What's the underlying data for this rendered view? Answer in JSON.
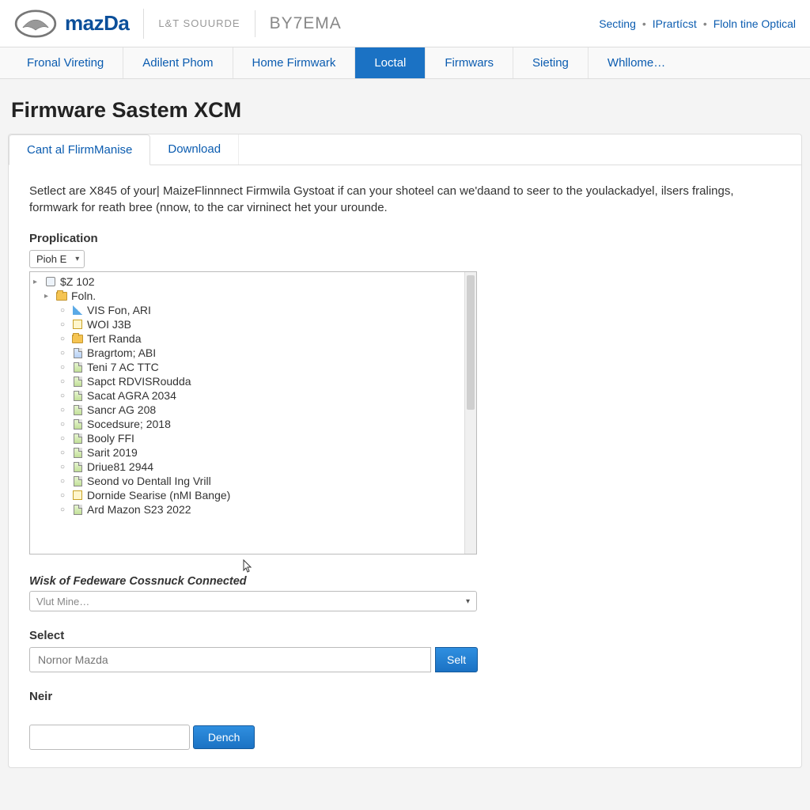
{
  "header": {
    "wordmark": "mazDa",
    "sub1": "L&T SOUURDE",
    "code": "BY7EMA",
    "links": [
      "Secting",
      "IPrartícst",
      "Floln tine Optical"
    ]
  },
  "nav": {
    "items": [
      "Fronal Vireting",
      "Adilent Phom",
      "Home Firmwark",
      "Loctal",
      "Firmwars",
      "Sieting",
      "Whllome…"
    ],
    "active_index": 3
  },
  "page": {
    "title": "Firmware Sastem XCM"
  },
  "tabs": {
    "items": [
      "Cant al FlirmManise",
      "Download"
    ],
    "active_index": 0
  },
  "intro": "Setlect are X845 of your| MaizeFlinnnect Firmwila Gystoat if can your shoteel can we'daand to seer to the youlackadyel, ilsers fralings, formwark for reath bree (nnow, to the car virninect het your urounde.",
  "proplication": {
    "label": "Proplication",
    "select_value": "Pioh  E",
    "tree": [
      {
        "lvl": 0,
        "icon": "db",
        "label": "$Z 102"
      },
      {
        "lvl": 1,
        "icon": "fold",
        "label": "Foln."
      },
      {
        "lvl": 2,
        "icon": "edit",
        "label": "VIS Fon, ARI"
      },
      {
        "lvl": 2,
        "icon": "note",
        "label": "WOI J3B"
      },
      {
        "lvl": 2,
        "icon": "fold",
        "label": "Tert Randa"
      },
      {
        "lvl": 2,
        "icon": "fb",
        "label": "Bragrtom; ABI"
      },
      {
        "lvl": 2,
        "icon": "fg",
        "label": "Teni 7 AC TTC"
      },
      {
        "lvl": 2,
        "icon": "fg",
        "label": "Sapct RDVISRoudda"
      },
      {
        "lvl": 2,
        "icon": "fg",
        "label": "Sacat AGRA 2034"
      },
      {
        "lvl": 2,
        "icon": "fg",
        "label": "Sancr AG 208"
      },
      {
        "lvl": 2,
        "icon": "fg",
        "label": "Socedsure; 2018"
      },
      {
        "lvl": 2,
        "icon": "fg",
        "label": "Booly FFI"
      },
      {
        "lvl": 2,
        "icon": "fg",
        "label": "Sarit 2019"
      },
      {
        "lvl": 2,
        "icon": "fg",
        "label": "Driue81 2944"
      },
      {
        "lvl": 2,
        "icon": "fg",
        "label": "Seond vo Dentall Ing Vrill"
      },
      {
        "lvl": 2,
        "icon": "note",
        "label": "Dornide Searise (nMI Bange)"
      },
      {
        "lvl": 2,
        "icon": "fg",
        "label": "Ard Mazon S23 2022"
      }
    ]
  },
  "wisk": {
    "label": "Wisk of Fedeware Cossnuck Connected",
    "placeholder": "Vlut Mine…"
  },
  "select_block": {
    "label": "Select",
    "placeholder": "Nornor Mazda",
    "button": "Selt"
  },
  "neir": {
    "label": "Neir"
  },
  "dench": {
    "label": "Dench"
  }
}
